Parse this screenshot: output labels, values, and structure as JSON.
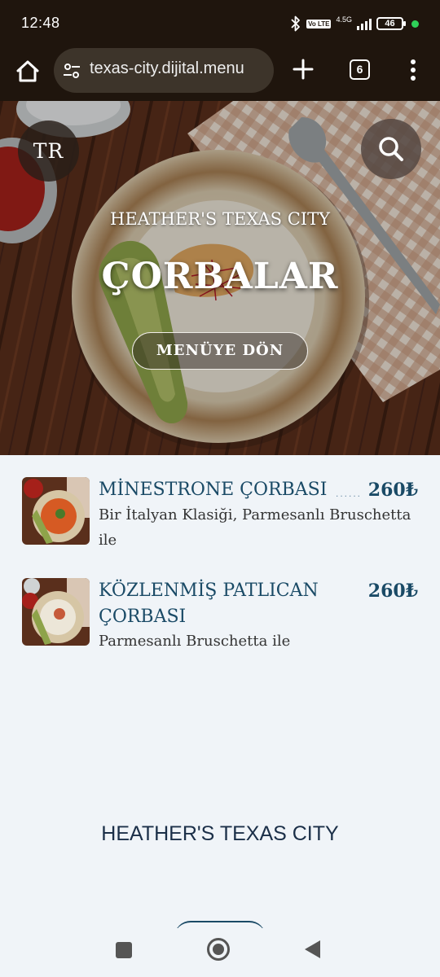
{
  "status_bar": {
    "time": "12:48",
    "volte": "Vo LTE",
    "network": "4.5G",
    "battery": "46",
    "icons": [
      "bluetooth-icon",
      "signal-icon",
      "battery-icon"
    ]
  },
  "browser": {
    "url": "texas-city.dijital.menu",
    "tab_count": "6",
    "icons": [
      "home-icon",
      "site-settings-icon",
      "new-tab-icon",
      "tab-switcher-icon",
      "more-options-icon"
    ]
  },
  "hero": {
    "language": "TR",
    "subtitle": "HEATHER'S TEXAS CITY",
    "title": "ÇORBALAR",
    "back_button": "MENÜYE DÖN"
  },
  "menu_items": [
    {
      "name_lines": [
        "MİNESTRONE ÇORBASI"
      ],
      "dots": "......",
      "price": "260₺",
      "description_lines": [
        "Bir İtalyan Klasiği, Parmesanlı Bruschetta",
        "ile"
      ]
    },
    {
      "name_lines": [
        "KÖZLENMİŞ PATLICAN",
        "ÇORBASI"
      ],
      "price": "260₺",
      "description_lines": [
        "Parmesanlı Bruschetta ile"
      ]
    }
  ],
  "footer": {
    "title": "HEATHER'S TEXAS CITY"
  },
  "nav_bar": {
    "icons": [
      "recent-apps-icon",
      "home-icon",
      "back-icon"
    ]
  },
  "colors": {
    "bar_bg": "#1f150d",
    "accent": "#1a4a66",
    "page_bg": "#f0f4f8"
  }
}
